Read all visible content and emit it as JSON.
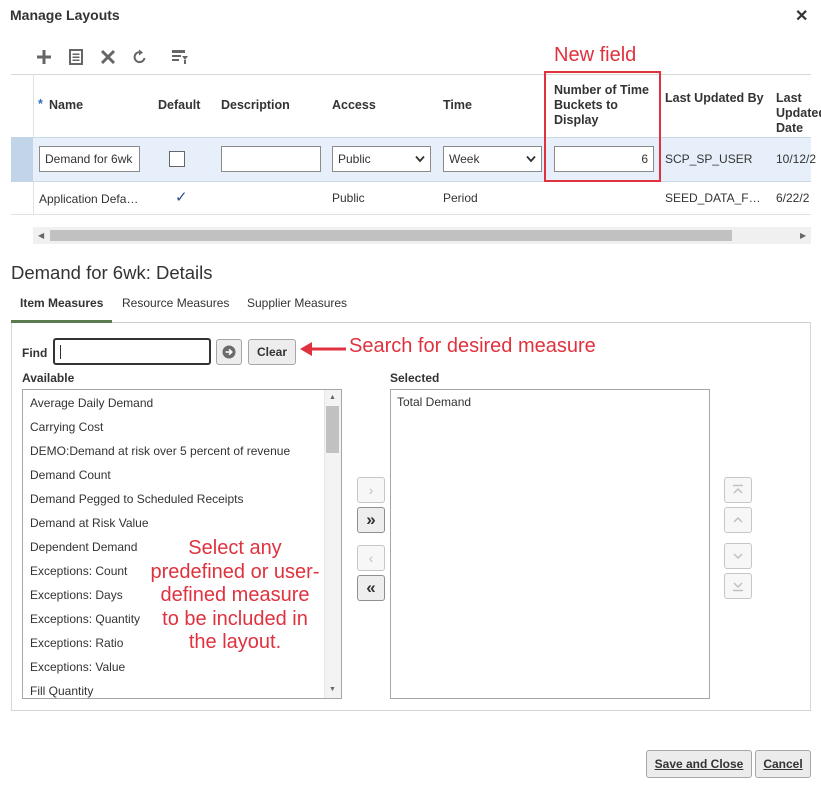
{
  "dialog": {
    "title": "Manage Layouts",
    "close_glyph": "✕"
  },
  "toolbar": {
    "icons": [
      "add-icon",
      "details-icon",
      "delete-icon",
      "refresh-icon",
      "format-icon"
    ]
  },
  "grid": {
    "headers": {
      "required_mark": "*",
      "name": "Name",
      "default": "Default",
      "description": "Description",
      "access": "Access",
      "time": "Time",
      "buckets": "Number of Time Buckets to Display",
      "last_updated_by": "Last Updated By",
      "last_updated_date": "Last Updated Date"
    },
    "rows": [
      {
        "name": "Demand for 6wk",
        "default": false,
        "description": "",
        "access": "Public",
        "time": "Week",
        "buckets": "6",
        "last_updated_by": "SCP_SP_USER",
        "last_updated_date": "10/12/2"
      },
      {
        "name": "Application Defa…",
        "default": true,
        "default_glyph": "✓",
        "description": "",
        "access": "Public",
        "time": "Period",
        "buckets": "",
        "last_updated_by": "SEED_DATA_F…",
        "last_updated_date": "6/22/2"
      }
    ]
  },
  "details": {
    "title": "Demand for 6wk: Details",
    "tabs": [
      "Item Measures",
      "Resource Measures",
      "Supplier Measures"
    ],
    "active_tab": "Item Measures",
    "find": {
      "label": "Find",
      "value": "",
      "clear_label": "Clear"
    },
    "available": {
      "label": "Available",
      "items": [
        "Average Daily Demand",
        "Carrying Cost",
        "DEMO:Demand at risk over 5 percent of revenue",
        "Demand Count",
        "Demand Pegged to Scheduled Receipts",
        "Demand at Risk Value",
        "Dependent Demand",
        "Exceptions: Count",
        "Exceptions: Days",
        "Exceptions: Quantity",
        "Exceptions: Ratio",
        "Exceptions: Value",
        "Fill Quantity"
      ]
    },
    "selected": {
      "label": "Selected",
      "items": [
        "Total Demand"
      ]
    },
    "shuttle": {
      "move": "›",
      "move_all": "»",
      "remove": "‹",
      "remove_all": "«"
    }
  },
  "footer": {
    "save_close": "Save and Close",
    "cancel": "Cancel"
  },
  "annotations": {
    "new_field": "New field",
    "search": "Search for desired measure",
    "select": "Select any predefined or user-defined measure to be included in the layout."
  },
  "colors": {
    "annotation": "#e0323e",
    "selected_row": "#e7f0fa",
    "tab_underline": "#5a7a52"
  }
}
